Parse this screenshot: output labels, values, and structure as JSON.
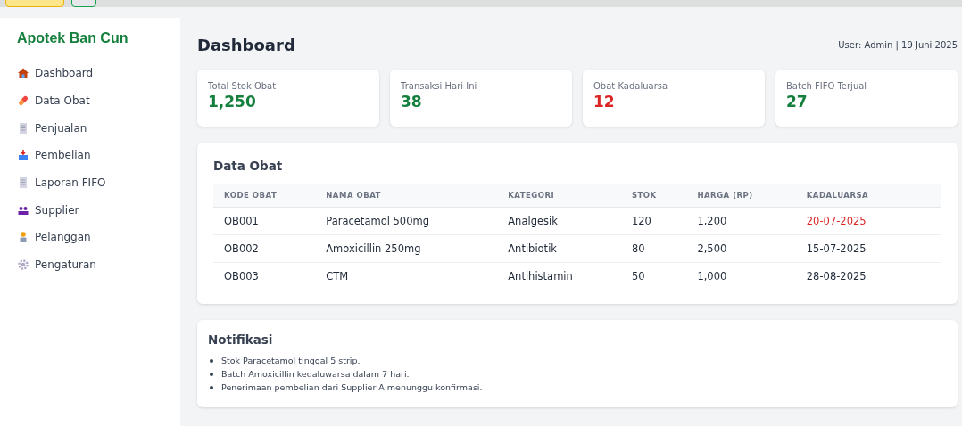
{
  "sidebar": {
    "brand": "Apotek Ban Cun",
    "items": [
      {
        "label": "Dashboard",
        "kind": "house"
      },
      {
        "label": "Data Obat",
        "kind": "pill"
      },
      {
        "label": "Penjualan",
        "kind": "doc"
      },
      {
        "label": "Pembelian",
        "kind": "inbox"
      },
      {
        "label": "Laporan FIFO",
        "kind": "doc"
      },
      {
        "label": "Supplier",
        "kind": "people"
      },
      {
        "label": "Pelanggan",
        "kind": "person"
      },
      {
        "label": "Pengaturan",
        "kind": "gear"
      }
    ]
  },
  "header": {
    "title": "Dashboard",
    "user_info": "User: Admin | 19 Juni 2025"
  },
  "stats": [
    {
      "label": "Total Stok Obat",
      "value": "1,250",
      "color": "#15803d"
    },
    {
      "label": "Transaksi Hari Ini",
      "value": "38",
      "color": "#15803d"
    },
    {
      "label": "Obat Kadaluarsa",
      "value": "12",
      "color": "#dc2626"
    },
    {
      "label": "Batch FIFO Terjual",
      "value": "27",
      "color": "#15803d"
    }
  ],
  "table": {
    "title": "Data Obat",
    "columns": [
      "KODE OBAT",
      "NAMA OBAT",
      "KATEGORI",
      "STOK",
      "HARGA (RP)",
      "KADALUARSA"
    ],
    "rows": [
      {
        "cells": [
          "OB001",
          "Paracetamol 500mg",
          "Analgesik",
          "120",
          "1,200",
          "20-07-2025"
        ],
        "expiring": true
      },
      {
        "cells": [
          "OB002",
          "Amoxicillin 250mg",
          "Antibiotik",
          "80",
          "2,500",
          "15-07-2025"
        ],
        "expiring": false
      },
      {
        "cells": [
          "OB003",
          "CTM",
          "Antihistamin",
          "50",
          "1,000",
          "28-08-2025"
        ],
        "expiring": false
      }
    ]
  },
  "notifications": {
    "title": "Notifikasi",
    "items": [
      "Stok Paracetamol tinggal 5 strip.",
      "Batch Amoxicillin kedaluwarsa dalam 7 hari.",
      "Penerimaan pembelian dari Supplier A menunggu konfirmasi."
    ]
  }
}
